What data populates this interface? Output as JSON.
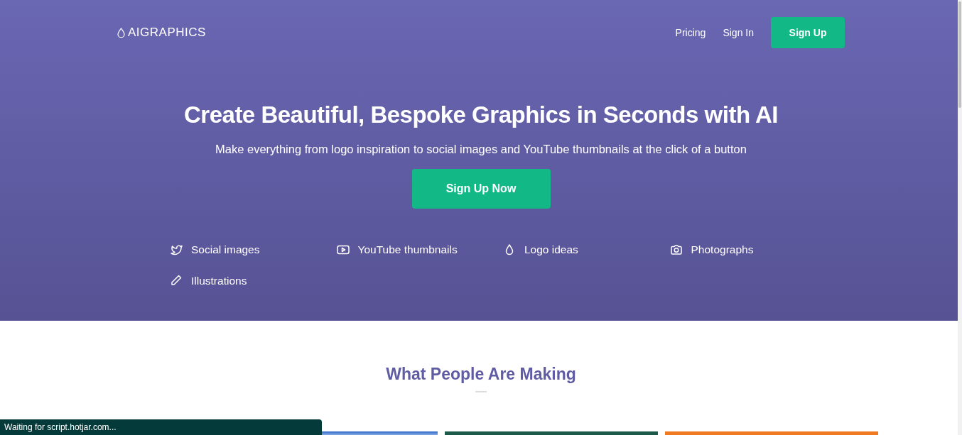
{
  "navbar": {
    "brand": "AIGRAPHICS",
    "links": [
      "Pricing",
      "Sign In"
    ],
    "cta": "Sign Up"
  },
  "hero": {
    "title": "Create Beautiful, Bespoke Graphics in Seconds with AI",
    "subtitle": "Make everything from logo inspiration to social images and YouTube thumbnails at the click of a button",
    "cta": "Sign Up Now",
    "features": [
      {
        "kind": "bird",
        "label": "Social images"
      },
      {
        "kind": "play",
        "label": "YouTube thumbnails"
      },
      {
        "kind": "drop",
        "label": "Logo ideas"
      },
      {
        "kind": "camera",
        "label": "Photographs"
      },
      {
        "kind": "pencil",
        "label": "Illustrations"
      }
    ]
  },
  "gallery": {
    "title": "What People Are Making",
    "items": [
      {
        "kind": "photo"
      },
      {
        "kind": "photo"
      },
      {
        "kind": "photo"
      }
    ]
  },
  "status_bar": {
    "text": "Waiting for script.hotjar.com..."
  }
}
